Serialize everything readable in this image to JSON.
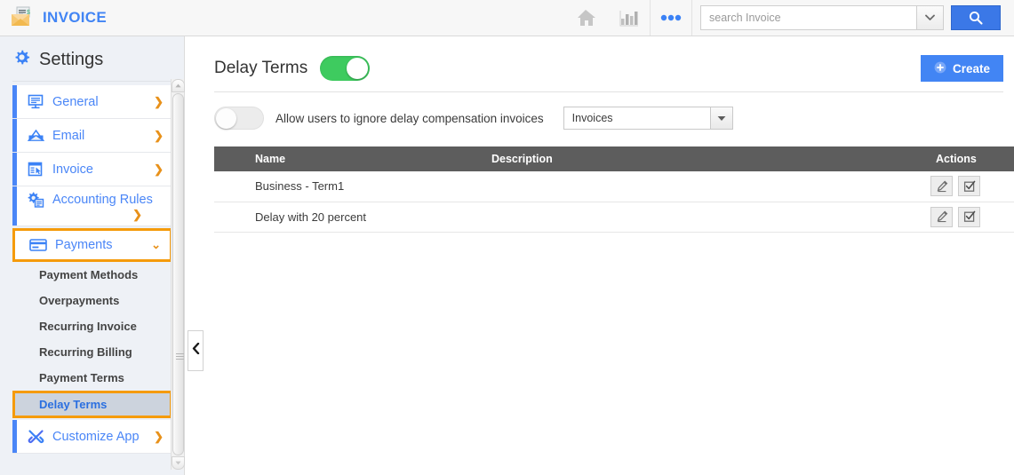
{
  "app": {
    "logo_icon": "envelope-invoice-icon",
    "title": "INVOICE"
  },
  "topbar": {
    "home_icon": "home-icon",
    "reports_icon": "bar-chart-icon",
    "more_icon": "more-dots-icon",
    "search": {
      "placeholder": "search Invoice",
      "value": "",
      "dropdown_icon": "chevron-down-icon",
      "button_icon": "search-icon"
    }
  },
  "sidebar": {
    "gear_icon": "gear-icon",
    "title": "Settings",
    "items": [
      {
        "label": "General",
        "icon": "monitor-icon",
        "chevron": "❯",
        "state": "collapsed"
      },
      {
        "label": "Email",
        "icon": "open-envelope-icon",
        "chevron": "❯",
        "state": "collapsed"
      },
      {
        "label": "Invoice",
        "icon": "document-cursor-icon",
        "chevron": "❯",
        "state": "collapsed"
      },
      {
        "label": "Accounting Rules",
        "icon": "gear-document-icon",
        "chevron": "❯",
        "state": "collapsed"
      },
      {
        "label": "Payments",
        "icon": "credit-card-icon",
        "chevron": "⌄",
        "state": "expanded"
      }
    ],
    "subitems": [
      {
        "label": "Payment Methods",
        "active": false
      },
      {
        "label": "Overpayments",
        "active": false
      },
      {
        "label": "Recurring Invoice",
        "active": false
      },
      {
        "label": "Recurring Billing",
        "active": false
      },
      {
        "label": "Payment Terms",
        "active": false
      },
      {
        "label": "Delay Terms",
        "active": true
      }
    ],
    "footer_item": {
      "label": "Customize App",
      "icon": "tools-icon",
      "chevron": "❯"
    },
    "collapse_icon": "chevron-left-icon",
    "scrollbar": {
      "up_icon": "arrow-up-icon",
      "down_icon": "arrow-down-icon"
    }
  },
  "main": {
    "page_title": "Delay Terms",
    "page_toggle": {
      "state": "on",
      "name": "delay-terms-toggle"
    },
    "create_button": {
      "label": "Create",
      "icon": "plus-circle-icon"
    },
    "filter": {
      "toggle_state": "off",
      "label": "Allow users to ignore delay compensation invoices",
      "select_value": "Invoices",
      "select_arrow_icon": "triangle-down-icon"
    },
    "table": {
      "columns": [
        "",
        "Name",
        "Description",
        "Actions"
      ],
      "rows": [
        {
          "name": "Business - Term1",
          "description": ""
        },
        {
          "name": "Delay with 20 percent",
          "description": ""
        }
      ],
      "row_actions": [
        {
          "icon": "pencil-edit-icon",
          "name": "edit-action"
        },
        {
          "icon": "checkbox-check-icon",
          "name": "select-action"
        }
      ]
    }
  },
  "colors": {
    "accent_blue": "#4285f4",
    "highlight_orange": "#f59b0b",
    "toggle_on_green": "#3ecb5f",
    "table_header_gray": "#5d5d5d",
    "sidebar_bg": "#eef1f6"
  }
}
